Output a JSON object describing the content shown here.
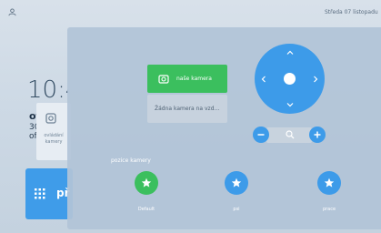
{
  "status_bar": {
    "date": "Středa 07 listopadu",
    "icons": [
      "user-icon"
    ]
  },
  "home": {
    "clock": "10:4",
    "day": "ot",
    "day_number": "30",
    "month": "of",
    "tile_label": "ovládání kamery",
    "tile_label_2": "př"
  },
  "panel": {
    "cameras": [
      {
        "label": "naše kamera",
        "active": true
      },
      {
        "label": "Žádna kamera na vzd...",
        "active": false
      }
    ],
    "positions_title": "pozice kamery",
    "presets": [
      {
        "label": "Default",
        "color": "#3bbf5e"
      },
      {
        "label": "psi",
        "color": "#3d9be9"
      },
      {
        "label": "prace",
        "color": "#3d9be9"
      }
    ]
  },
  "colors": {
    "accent_blue": "#3d9be9",
    "accent_green": "#3bbf5e"
  }
}
